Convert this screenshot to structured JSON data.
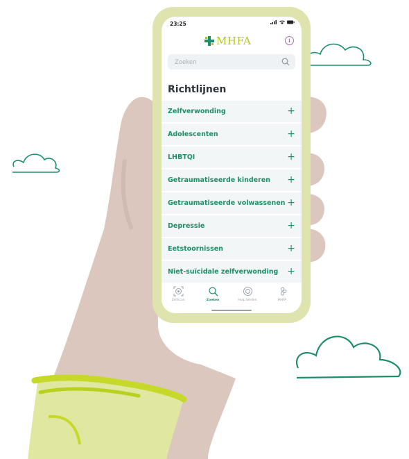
{
  "status": {
    "time": "23:25",
    "icons": "▮▮▮ ≈ ▬"
  },
  "app": {
    "logo_text": "MHFA",
    "info_glyph": "i"
  },
  "search": {
    "placeholder": "Zoeken"
  },
  "section": {
    "title": "Richtlijnen"
  },
  "guidelines": [
    {
      "label": "Zelfverwonding",
      "action": "+"
    },
    {
      "label": "Adolescenten",
      "action": "+"
    },
    {
      "label": "LHBTQI",
      "action": "+"
    },
    {
      "label": "Getraumatiseerde kinderen",
      "action": "+"
    },
    {
      "label": "Getraumatiseerde volwassenen",
      "action": "+"
    },
    {
      "label": "Depressie",
      "action": "+"
    },
    {
      "label": "Eetstoornissen",
      "action": "+"
    },
    {
      "label": "Niet-suïcidale zelfverwonding",
      "action": "+"
    }
  ],
  "tabs": [
    {
      "label": "Zelfscan",
      "icon": "scan-icon"
    },
    {
      "label": "Zoeken",
      "icon": "search-icon",
      "active": true
    },
    {
      "label": "Hulp bieden",
      "icon": "lifebuoy-icon"
    },
    {
      "label": "MHFA",
      "icon": "flower-icon"
    }
  ],
  "colors": {
    "accent": "#1d8f67",
    "logo": "#b3c61d",
    "phone_frame": "#dfe3ad",
    "info": "#a66aa8",
    "list_bg": "#f3f6f7",
    "skin": "#dcc7be",
    "sleeve": "#d4e06a",
    "cloud": "#1d8f67"
  }
}
